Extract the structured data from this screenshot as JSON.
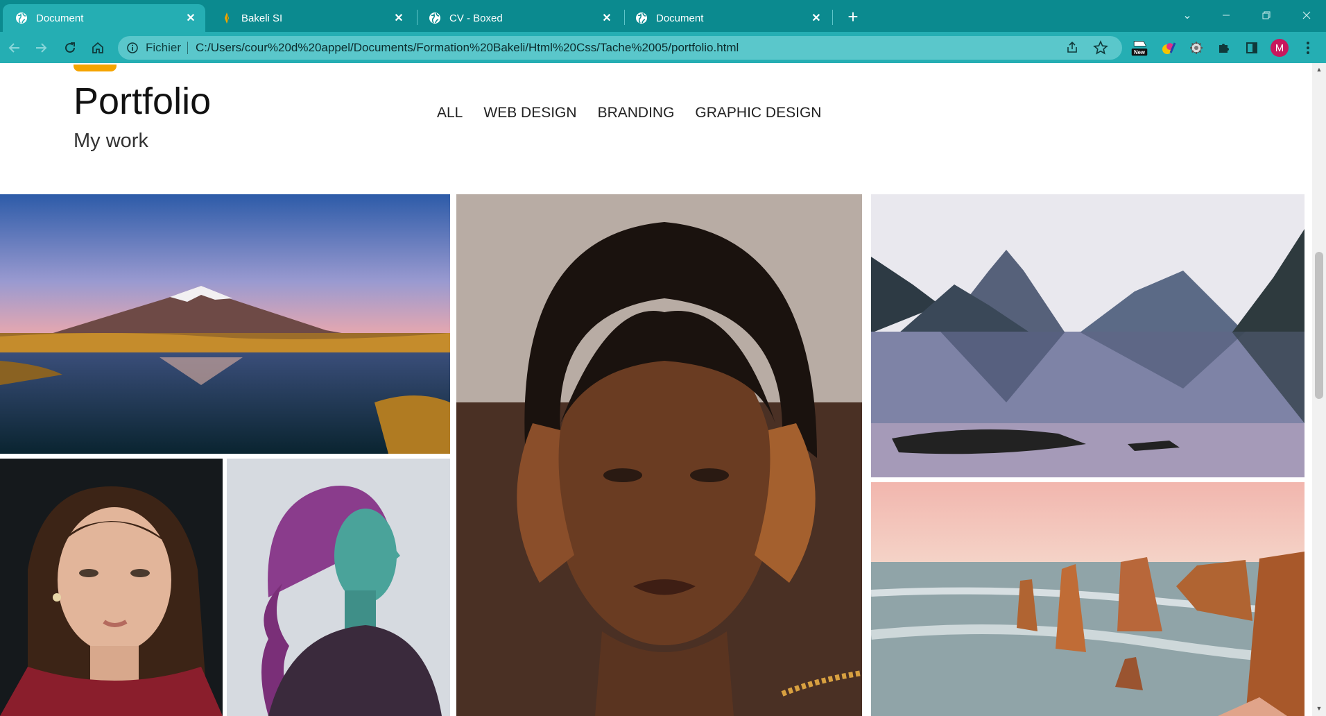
{
  "browser": {
    "tabs": [
      {
        "title": "Document",
        "icon": "globe-icon",
        "active": true
      },
      {
        "title": "Bakeli SI",
        "icon": "bakeli-favicon",
        "active": false
      },
      {
        "title": "CV - Boxed",
        "icon": "globe-icon",
        "active": false
      },
      {
        "title": "Document",
        "icon": "globe-icon",
        "active": false
      }
    ],
    "omnibox": {
      "scheme_label": "Fichier",
      "url": "C:/Users/cour%20d%20appel/Documents/Formation%20Bakeli/Html%20Css/Tache%2005/portfolio.html"
    },
    "extensions": {
      "new_badge": "New"
    },
    "profile_initial": "M",
    "colors": {
      "tabstrip": "#0b8a8f",
      "toolbar": "#25aeb3",
      "omnibox": "#5ac7cb",
      "avatar": "#c8175d"
    }
  },
  "page": {
    "title": "Portfolio",
    "subtitle": "My work",
    "accent_color": "#f5a400",
    "filters": [
      "ALL",
      "WEB DESIGN",
      "BRANDING",
      "GRAPHIC DESIGN"
    ],
    "gallery": [
      {
        "name": "mountain-lake-photo",
        "subject": "snow-capped volcano reflected in lake at dusk"
      },
      {
        "name": "woman-portrait-photo",
        "subject": "portrait of woman with long wavy hair"
      },
      {
        "name": "purple-hair-portrait-photo",
        "subject": "profile of woman with purple braided hair"
      },
      {
        "name": "dreadlocks-portrait-photo",
        "subject": "close-up portrait of woman with dreadlocks"
      },
      {
        "name": "fjord-photo",
        "subject": "mountains reflected in calm fjord"
      },
      {
        "name": "sea-stacks-photo",
        "subject": "coastal rock stacks at sunset"
      }
    ]
  }
}
